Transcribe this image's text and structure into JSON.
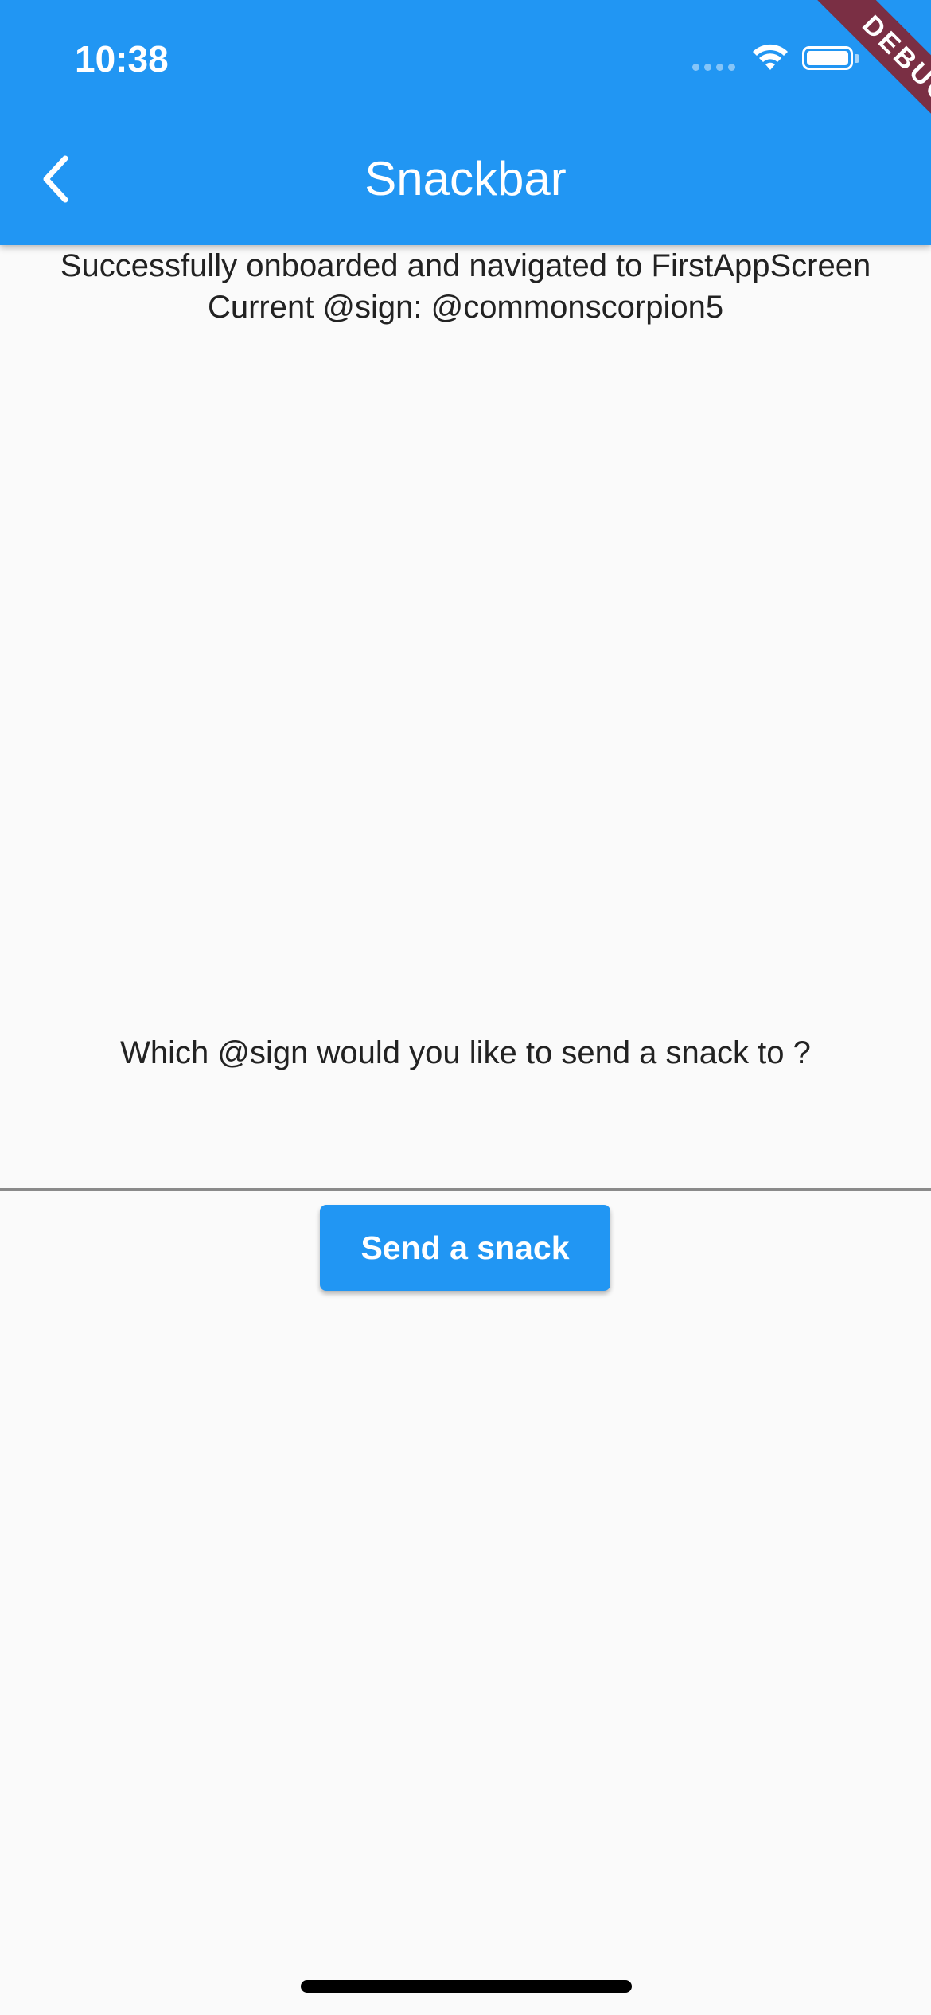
{
  "status_bar": {
    "time": "10:38"
  },
  "app_bar": {
    "title": "Snackbar",
    "back_icon": "chevron-left-icon"
  },
  "debug_banner": {
    "label": "DEBUG"
  },
  "content": {
    "line1": "Successfully onboarded and navigated to FirstAppScreen",
    "line2": "Current @sign: @commonscorpion5",
    "prompt": "Which @sign would you like to send a snack to ?",
    "input_value": "",
    "send_button_label": "Send a snack"
  },
  "colors": {
    "primary": "#2196f3",
    "background": "#fafafa",
    "debug_banner": "#7a2f44"
  }
}
